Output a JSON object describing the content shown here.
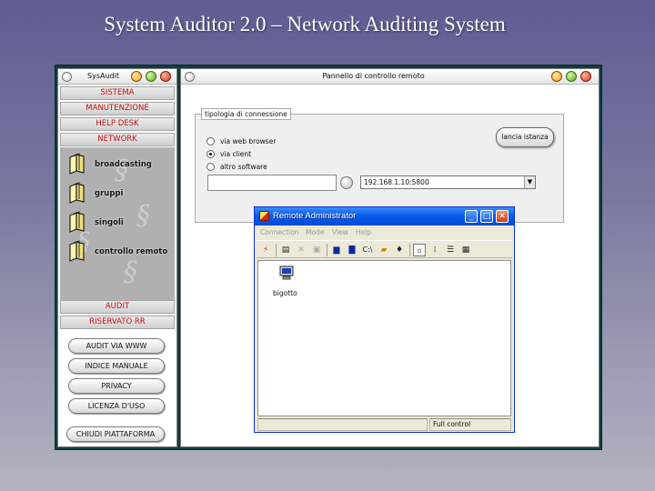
{
  "slide": {
    "title": "System Auditor 2.0 – Network Auditing System"
  },
  "left_panel": {
    "title": "SysAudit",
    "menu": [
      "SISTEMA",
      "MANUTENZIONE",
      "HELP DESK",
      "NETWORK"
    ],
    "network_items": [
      "broadcasting",
      "gruppi",
      "singoli",
      "controllo remoto"
    ],
    "menu_bottom": [
      "AUDIT",
      "RISERVATO RR"
    ],
    "buttons": [
      "AUDIT VIA WWW",
      "INDICE MANUALE",
      "PRIVACY",
      "LICENZA D'USO"
    ],
    "exit_button": "CHIUDI PIATTAFORMA"
  },
  "right_panel": {
    "title": "Pannello di controllo remoto",
    "group_label": "tipologia di connessione",
    "options": [
      {
        "label": "via web browser",
        "selected": false
      },
      {
        "label": "via client",
        "selected": true
      },
      {
        "label": "altro software",
        "selected": false
      }
    ],
    "launch_button": "lancia istanza",
    "text_value": "",
    "ip_value": "192.168.1.10:5800"
  },
  "remote_admin": {
    "title": "Remote Administrator",
    "menus": [
      "Connection",
      "Mode",
      "View",
      "Help"
    ],
    "computer_label": "bigotto",
    "status_right": "Full control",
    "status_left": ""
  },
  "colors": {
    "menu_red": "#c01010",
    "xp_blue": "#0a5ee8",
    "frame_teal": "#0f3e3c"
  }
}
